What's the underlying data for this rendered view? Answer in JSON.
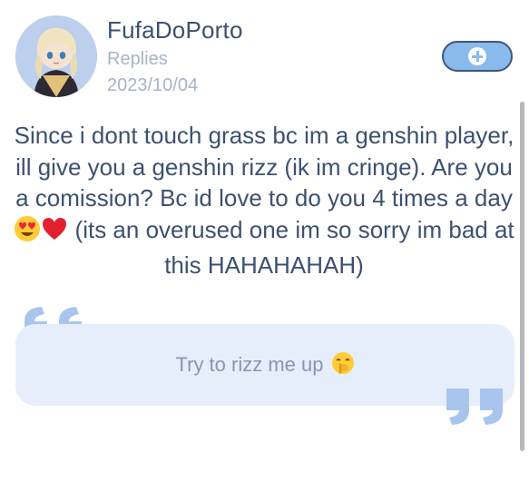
{
  "post": {
    "username": "FufaDoPorto",
    "type": "Replies",
    "date": "2023/10/04",
    "body_part1": "Since i dont touch grass bc im a genshin player, ill give you a genshin rizz (ik im cringe). Are you a comission? Bc id love to do you 4 times a day",
    "body_part2": " (its an overused one im so sorry im bad at this HAHAHAHAH)"
  },
  "prompt": {
    "text": "Try to rizz me up"
  },
  "icons": {
    "avatar": "anime-character-avatar",
    "add": "plus-circle-icon",
    "body_emojis": [
      "heart-eyes-emoji",
      "red-heart-emoji"
    ],
    "prompt_emoji": "shushing-face-emoji",
    "quotes": [
      "open-quote-icon",
      "close-quote-icon"
    ]
  },
  "colors": {
    "text_primary": "#3c5171",
    "text_muted": "#a7b3c6",
    "accent": "#8ab9ec",
    "prompt_bg": "#e7eefb",
    "quote": "#a9c5ee"
  }
}
